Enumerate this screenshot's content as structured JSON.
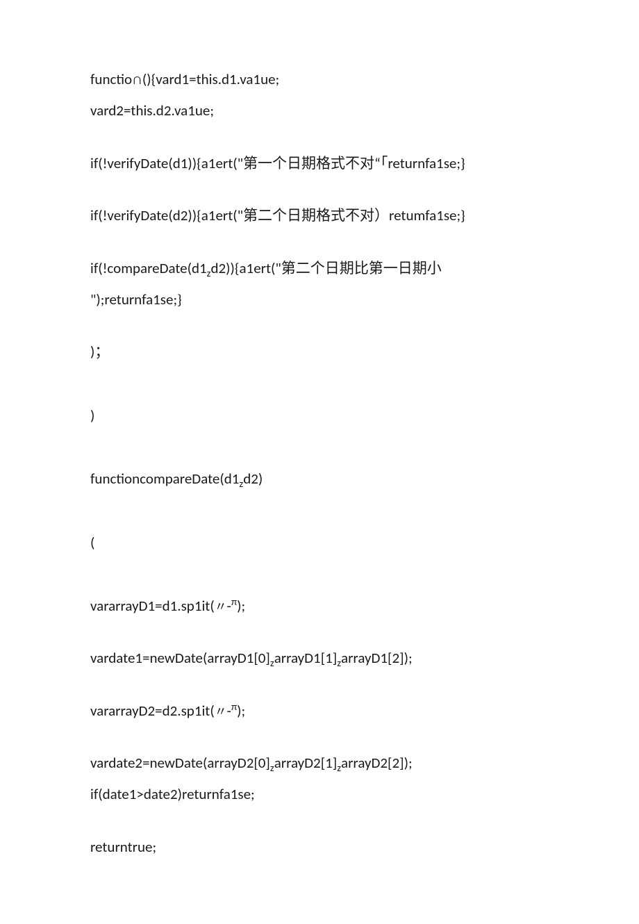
{
  "lines": {
    "l1": "functio∩(){vard1=this.d1.va1ue;",
    "l2": "vard2=this.d2.va1ue;",
    "l3": "if(!verifyDate(d1)){a1ert(\"第一个日期格式不对“「returnfa1se;}",
    "l4": "if(!verifyDate(d2)){a1ert(\"第二个日期格式不对）retumfa1se;}",
    "l5a": "if(!compareDate(d1",
    "l5b": "z",
    "l5c": "d2)){a1ert(\"第二个日期比第一日期小",
    "l6": "\");returnfa1se;}",
    "l7": ")；",
    "l8": ")",
    "l9a": "functioncompareDate(d1",
    "l9b": "z",
    "l9c": "d2)",
    "l10": "(",
    "l11a": "vararrayD1=d1.sp1it(",
    "l11b": "〃",
    "l11c": "-",
    "l11d": "π",
    "l11e": ");",
    "l12a": "vardate1=newDate(arrayD1[0]",
    "l12b": "z",
    "l12c": "arrayD1[1]",
    "l12d": "z",
    "l12e": "arrayD1[2]);",
    "l13a": "vararrayD2=d2.sp1it(",
    "l13b": "〃",
    "l13c": "-",
    "l13d": "π",
    "l13e": ");",
    "l14a": "vardate2=newDate(arrayD2[0]",
    "l14b": "z",
    "l14c": "arrayD2[1]",
    "l14d": "z",
    "l14e": "arrayD2[2]);",
    "l15": "if(date1>date2)returnfa1se;",
    "l16": "returntrue;"
  }
}
